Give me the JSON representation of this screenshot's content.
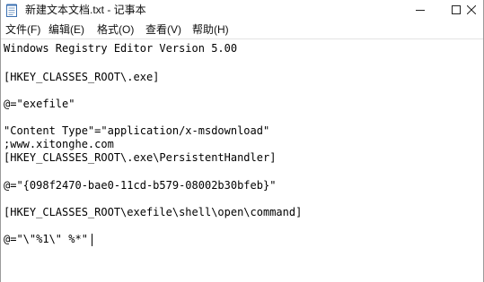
{
  "window": {
    "title": "新建文本文档.txt - 记事本"
  },
  "menu": {
    "file": "文件(F)",
    "edit": "编辑(E)",
    "format": "格式(O)",
    "view": "查看(V)",
    "help": "帮助(H)"
  },
  "editor": {
    "lines": [
      "Windows Registry Editor Version 5.00",
      "[HKEY_CLASSES_ROOT\\.exe]",
      "@=\"exefile\"",
      "\"Content Type\"=\"application/x-msdownload\"",
      ";www.xitonghe.com",
      "[HKEY_CLASSES_ROOT\\.exe\\PersistentHandler]",
      "@=\"{098f2470-bae0-11cd-b579-08002b30bfeb}\"",
      "[HKEY_CLASSES_ROOT\\exefile\\shell\\open\\command]",
      "@=\"\\\"%1\\\" %*\""
    ]
  },
  "icons": {
    "app": "notepad-icon",
    "minimize": "minimize-icon",
    "maximize": "maximize-icon",
    "close": "close-icon"
  }
}
